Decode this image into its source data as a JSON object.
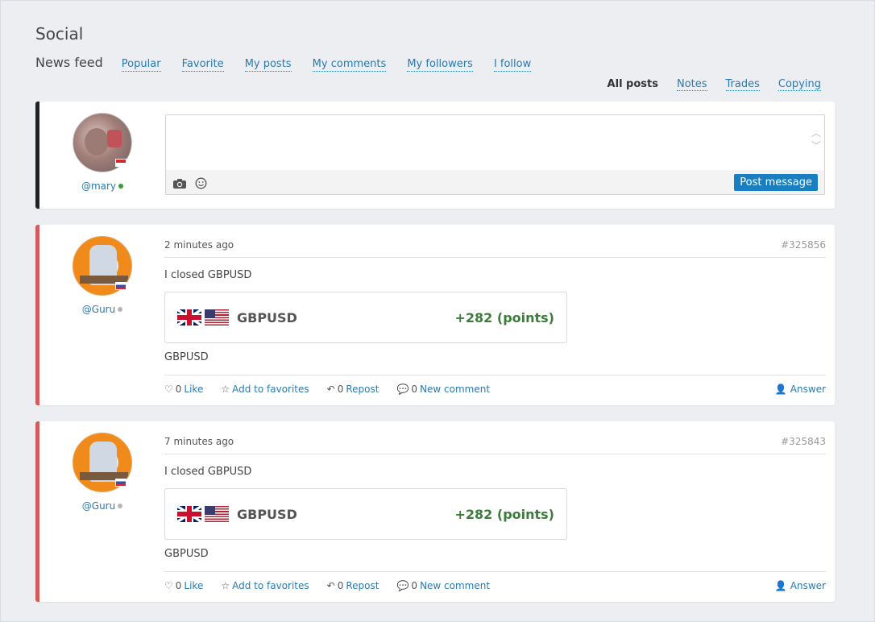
{
  "page": {
    "title": "Social",
    "feed_title": "News feed",
    "top_tabs": [
      "Popular",
      "Favorite",
      "My posts",
      "My comments",
      "My followers",
      "I follow"
    ],
    "filter_tabs": {
      "active": "All posts",
      "others": [
        "Notes",
        "Trades",
        "Copying"
      ]
    }
  },
  "compose": {
    "user": "@mary",
    "status": "online",
    "placeholder": "",
    "post_button": "Post message"
  },
  "posts": [
    {
      "user": "@Guru",
      "status": "offline",
      "time": "2 minutes ago",
      "id": "#325856",
      "text": "I closed GBPUSD",
      "trade": {
        "pair": "GBPUSD",
        "result": "+282 (points)"
      },
      "subtext": "GBPUSD",
      "actions": {
        "like_count": "0",
        "like_label": "Like",
        "fav_label": "Add to favorites",
        "repost_count": "0",
        "repost_label": "Repost",
        "comment_count": "0",
        "comment_label": "New comment",
        "answer_label": "Answer"
      }
    },
    {
      "user": "@Guru",
      "status": "offline",
      "time": "7 minutes ago",
      "id": "#325843",
      "text": "I closed GBPUSD",
      "trade": {
        "pair": "GBPUSD",
        "result": "+282 (points)"
      },
      "subtext": "GBPUSD",
      "actions": {
        "like_count": "0",
        "like_label": "Like",
        "fav_label": "Add to favorites",
        "repost_count": "0",
        "repost_label": "Repost",
        "comment_count": "0",
        "comment_label": "New comment",
        "answer_label": "Answer"
      }
    }
  ],
  "colors": {
    "link": "#2a7ab0",
    "accent_button": "#1a7fc0",
    "post_border": "#d25c5c",
    "profit": "#3c7d3c",
    "online": "#3a9b3a"
  }
}
